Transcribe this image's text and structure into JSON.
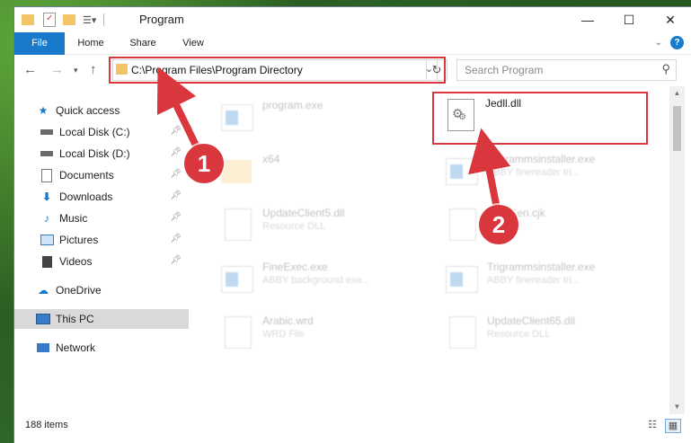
{
  "window": {
    "title": "Program",
    "controls": {
      "minimize": "—",
      "maximize": "☐",
      "close": "✕"
    }
  },
  "ribbon": {
    "tabs": [
      {
        "label": "File"
      },
      {
        "label": "Home"
      },
      {
        "label": "Share"
      },
      {
        "label": "View"
      }
    ],
    "help": "?"
  },
  "address": {
    "path": "C:\\Program Files\\Program Directory",
    "search_placeholder": "Search Program"
  },
  "nav_pane": {
    "items": [
      {
        "label": "Quick access",
        "icon": "star-icon"
      },
      {
        "label": "Local Disk (C:)",
        "icon": "drive-icon",
        "pinned": true
      },
      {
        "label": "Local Disk (D:)",
        "icon": "drive-icon",
        "pinned": true
      },
      {
        "label": "Documents",
        "icon": "documents-icon",
        "pinned": true
      },
      {
        "label": "Downloads",
        "icon": "download-icon",
        "pinned": true
      },
      {
        "label": "Music",
        "icon": "music-icon",
        "pinned": true
      },
      {
        "label": "Pictures",
        "icon": "pictures-icon",
        "pinned": true
      },
      {
        "label": "Videos",
        "icon": "videos-icon",
        "pinned": true
      },
      {
        "label": "OneDrive",
        "icon": "cloud-icon"
      },
      {
        "label": "This PC",
        "icon": "computer-icon",
        "selected": true
      },
      {
        "label": "Network",
        "icon": "network-icon"
      }
    ]
  },
  "files": [
    {
      "name": "program.exe",
      "sub": "",
      "icon": "exe-icon",
      "faded": true
    },
    {
      "name": "Jedll.dll",
      "sub": "",
      "icon": "dll-gear-icon",
      "faded": false
    },
    {
      "name": "x64",
      "sub": "",
      "icon": "folder-icon",
      "faded": true
    },
    {
      "name": "Trigrammsinstaller.exe",
      "sub": "ABBY finereader tri...",
      "icon": "app-icon",
      "faded": true
    },
    {
      "name": "UpdateClient5.dll",
      "sub": "Resource DLL",
      "icon": "dll-icon",
      "faded": true
    },
    {
      "name": "FontGen.cjk",
      "sub": "",
      "icon": "file-icon",
      "faded": true
    },
    {
      "name": "FineExec.exe",
      "sub": "ABBY background exe...",
      "icon": "app-icon",
      "faded": true
    },
    {
      "name": "Trigrammsinstaller.exe",
      "sub": "ABBY finereader tri...",
      "icon": "app-icon",
      "faded": true
    },
    {
      "name": "Arabic.wrd",
      "sub": "WRD File",
      "icon": "file-icon",
      "faded": true
    },
    {
      "name": "UpdateClient65.dll",
      "sub": "Resource DLL",
      "icon": "dll-icon",
      "faded": true
    }
  ],
  "status": {
    "items_count": "188 items"
  },
  "annotations": {
    "badge1": "1",
    "badge2": "2",
    "highlight_color": "#d9363e"
  }
}
